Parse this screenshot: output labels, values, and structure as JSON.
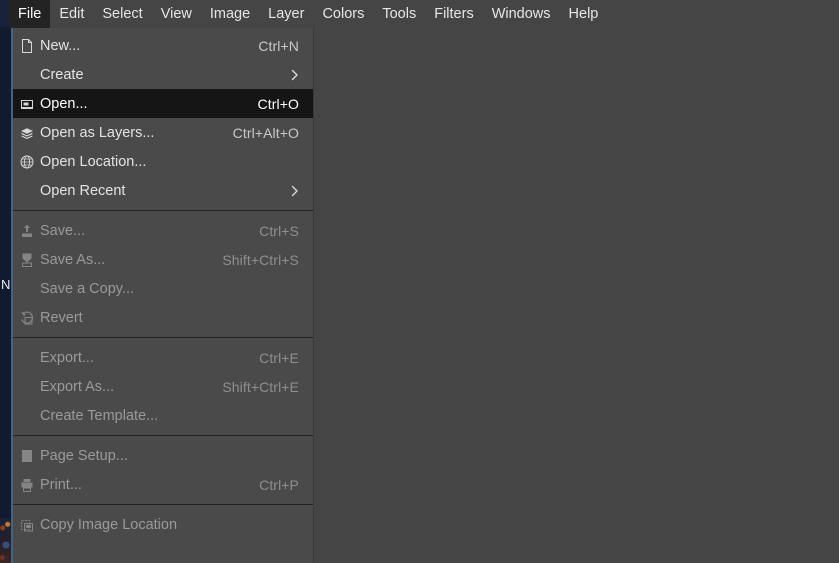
{
  "window": {
    "background_color": "#454545",
    "menu_background_color": "#4a4a4a",
    "highlight_color": "#151515"
  },
  "underlay": {
    "name": "background-application",
    "visible_letter": "N",
    "strip_color": "#111a2e",
    "accent_color": "#3f6488"
  },
  "menubar": {
    "items": [
      {
        "label": "File",
        "active": true,
        "name": "menubar-item-file"
      },
      {
        "label": "Edit",
        "active": false,
        "name": "menubar-item-edit"
      },
      {
        "label": "Select",
        "active": false,
        "name": "menubar-item-select"
      },
      {
        "label": "View",
        "active": false,
        "name": "menubar-item-view"
      },
      {
        "label": "Image",
        "active": false,
        "name": "menubar-item-image"
      },
      {
        "label": "Layer",
        "active": false,
        "name": "menubar-item-layer"
      },
      {
        "label": "Colors",
        "active": false,
        "name": "menubar-item-colors"
      },
      {
        "label": "Tools",
        "active": false,
        "name": "menubar-item-tools"
      },
      {
        "label": "Filters",
        "active": false,
        "name": "menubar-item-filters"
      },
      {
        "label": "Windows",
        "active": false,
        "name": "menubar-item-windows"
      },
      {
        "label": "Help",
        "active": false,
        "name": "menubar-item-help"
      }
    ]
  },
  "file_menu": {
    "items": [
      {
        "type": "item",
        "label": "New...",
        "accel": "Ctrl+N",
        "icon": "new-document-icon",
        "disabled": false,
        "selected": false,
        "submenu": false
      },
      {
        "type": "item",
        "label": "Create",
        "accel": "",
        "icon": "",
        "disabled": false,
        "selected": false,
        "submenu": true
      },
      {
        "type": "item",
        "label": "Open...",
        "accel": "Ctrl+O",
        "icon": "open-folder-icon",
        "disabled": false,
        "selected": true,
        "submenu": false
      },
      {
        "type": "item",
        "label": "Open as Layers...",
        "accel": "Ctrl+Alt+O",
        "icon": "layers-icon",
        "disabled": false,
        "selected": false,
        "submenu": false
      },
      {
        "type": "item",
        "label": "Open Location...",
        "accel": "",
        "icon": "globe-icon",
        "disabled": false,
        "selected": false,
        "submenu": false
      },
      {
        "type": "item",
        "label": "Open Recent",
        "accel": "",
        "icon": "",
        "disabled": false,
        "selected": false,
        "submenu": true
      },
      {
        "type": "separator"
      },
      {
        "type": "item",
        "label": "Save...",
        "accel": "Ctrl+S",
        "icon": "save-icon",
        "disabled": true,
        "selected": false,
        "submenu": false
      },
      {
        "type": "item",
        "label": "Save As...",
        "accel": "Shift+Ctrl+S",
        "icon": "save-as-icon",
        "disabled": true,
        "selected": false,
        "submenu": false
      },
      {
        "type": "item",
        "label": "Save a Copy...",
        "accel": "",
        "icon": "",
        "disabled": true,
        "selected": false,
        "submenu": false
      },
      {
        "type": "item",
        "label": "Revert",
        "accel": "",
        "icon": "revert-icon",
        "disabled": true,
        "selected": false,
        "submenu": false
      },
      {
        "type": "separator"
      },
      {
        "type": "item",
        "label": "Export...",
        "accel": "Ctrl+E",
        "icon": "",
        "disabled": true,
        "selected": false,
        "submenu": false
      },
      {
        "type": "item",
        "label": "Export As...",
        "accel": "Shift+Ctrl+E",
        "icon": "",
        "disabled": true,
        "selected": false,
        "submenu": false
      },
      {
        "type": "item",
        "label": "Create Template...",
        "accel": "",
        "icon": "",
        "disabled": true,
        "selected": false,
        "submenu": false
      },
      {
        "type": "separator"
      },
      {
        "type": "item",
        "label": "Page Setup...",
        "accel": "",
        "icon": "page-setup-icon",
        "disabled": true,
        "selected": false,
        "submenu": false
      },
      {
        "type": "item",
        "label": "Print...",
        "accel": "Ctrl+P",
        "icon": "print-icon",
        "disabled": true,
        "selected": false,
        "submenu": false
      },
      {
        "type": "separator"
      },
      {
        "type": "item",
        "label": "Copy Image Location",
        "accel": "",
        "icon": "copy-location-icon",
        "disabled": true,
        "selected": false,
        "submenu": false
      }
    ]
  }
}
